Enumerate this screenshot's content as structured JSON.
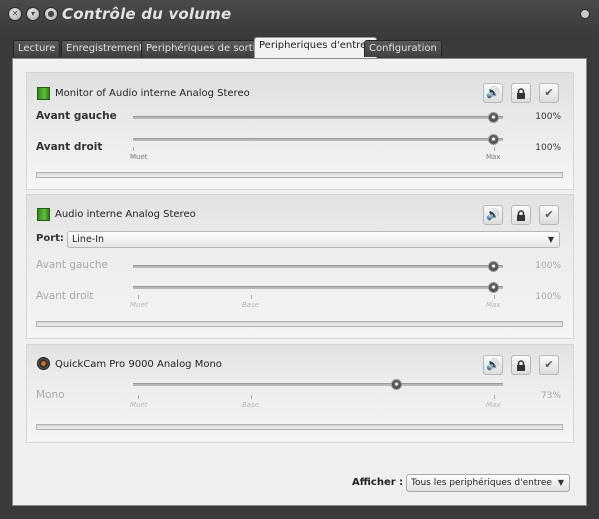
{
  "window": {
    "title": "Contrôle du volume"
  },
  "tabs": [
    {
      "label": "Lecture"
    },
    {
      "label": "Enregistrement"
    },
    {
      "label": "Periphériques de sortie"
    },
    {
      "label": "Peripheriques d'entree"
    },
    {
      "label": "Configuration"
    }
  ],
  "active_tab": 3,
  "devices": [
    {
      "name": "Monitor of Audio interne Analog Stereo",
      "icon": "audio-card-icon",
      "channels": [
        {
          "label": "Avant gauche",
          "value_text": "100%",
          "level": 1.0
        },
        {
          "label": "Avant droit",
          "value_text": "100%",
          "level": 1.0
        }
      ],
      "scale": {
        "min": "Muet",
        "max": "Max"
      }
    },
    {
      "name": "Audio interne Analog Stereo",
      "icon": "audio-card-icon",
      "port_label": "Port:",
      "port_value": "Line-In",
      "channels": [
        {
          "label": "Avant gauche",
          "value_text": "100%",
          "level": 1.0
        },
        {
          "label": "Avant droit",
          "value_text": "100%",
          "level": 1.0
        }
      ],
      "scale": {
        "min": "Muet",
        "base": "Base",
        "max": "Max"
      }
    },
    {
      "name": "QuickCam Pro 9000 Analog Mono",
      "icon": "webcam-icon",
      "channels": [
        {
          "label": "Mono",
          "value_text": "73%",
          "level": 0.73
        }
      ],
      "scale": {
        "min": "Muet",
        "base": "Base",
        "max": "Max"
      }
    }
  ],
  "footer": {
    "show_label": "Afficher :",
    "show_value": "Tous les periphériques d'entree"
  }
}
